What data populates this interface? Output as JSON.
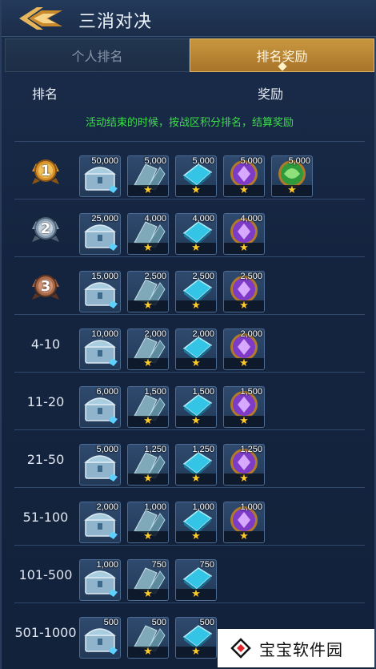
{
  "header": {
    "title": "三消对决"
  },
  "tabs": [
    {
      "label": "个人排名",
      "active": false
    },
    {
      "label": "排名奖励",
      "active": true
    }
  ],
  "columns": {
    "rank": "排名",
    "reward": "奖励"
  },
  "notice": "活动结束的时候，按战区积分排名，结算奖励",
  "rows": [
    {
      "rank_label": "",
      "medal": "gold",
      "medal_number": "1",
      "rewards": [
        {
          "type": "chest",
          "count": "50,000",
          "starred": false
        },
        {
          "type": "shard",
          "count": "5,000",
          "starred": true
        },
        {
          "type": "blue-gem",
          "count": "5,000",
          "starred": true
        },
        {
          "type": "purple-orb",
          "count": "5,000",
          "starred": true
        },
        {
          "type": "green-orb",
          "count": "5,000",
          "starred": true
        }
      ]
    },
    {
      "rank_label": "",
      "medal": "silver",
      "medal_number": "2",
      "rewards": [
        {
          "type": "chest",
          "count": "25,000",
          "starred": false
        },
        {
          "type": "shard",
          "count": "4,000",
          "starred": true
        },
        {
          "type": "blue-gem",
          "count": "4,000",
          "starred": true
        },
        {
          "type": "purple-orb",
          "count": "4,000",
          "starred": true
        }
      ]
    },
    {
      "rank_label": "",
      "medal": "bronze",
      "medal_number": "3",
      "rewards": [
        {
          "type": "chest",
          "count": "15,000",
          "starred": false
        },
        {
          "type": "shard",
          "count": "2,500",
          "starred": true
        },
        {
          "type": "blue-gem",
          "count": "2,500",
          "starred": true
        },
        {
          "type": "purple-orb",
          "count": "2,500",
          "starred": true
        }
      ]
    },
    {
      "rank_label": "4-10",
      "rewards": [
        {
          "type": "chest",
          "count": "10,000",
          "starred": false
        },
        {
          "type": "shard",
          "count": "2,000",
          "starred": true
        },
        {
          "type": "blue-gem",
          "count": "2,000",
          "starred": true
        },
        {
          "type": "purple-orb",
          "count": "2,000",
          "starred": true
        }
      ]
    },
    {
      "rank_label": "11-20",
      "rewards": [
        {
          "type": "chest",
          "count": "6,000",
          "starred": false
        },
        {
          "type": "shard",
          "count": "1,500",
          "starred": true
        },
        {
          "type": "blue-gem",
          "count": "1,500",
          "starred": true
        },
        {
          "type": "purple-orb",
          "count": "1,500",
          "starred": true
        }
      ]
    },
    {
      "rank_label": "21-50",
      "rewards": [
        {
          "type": "chest",
          "count": "5,000",
          "starred": false
        },
        {
          "type": "shard",
          "count": "1,250",
          "starred": true
        },
        {
          "type": "blue-gem",
          "count": "1,250",
          "starred": true
        },
        {
          "type": "purple-orb",
          "count": "1,250",
          "starred": true
        }
      ]
    },
    {
      "rank_label": "51-100",
      "rewards": [
        {
          "type": "chest",
          "count": "2,000",
          "starred": false
        },
        {
          "type": "shard",
          "count": "1,000",
          "starred": true
        },
        {
          "type": "blue-gem",
          "count": "1,000",
          "starred": true
        },
        {
          "type": "purple-orb",
          "count": "1,000",
          "starred": true
        }
      ]
    },
    {
      "rank_label": "101-500",
      "rewards": [
        {
          "type": "chest",
          "count": "1,000",
          "starred": false
        },
        {
          "type": "shard",
          "count": "750",
          "starred": true
        },
        {
          "type": "blue-gem",
          "count": "750",
          "starred": true
        }
      ]
    },
    {
      "rank_label": "501-1000",
      "rewards": [
        {
          "type": "chest",
          "count": "500",
          "starred": false
        },
        {
          "type": "shard",
          "count": "500",
          "starred": true
        },
        {
          "type": "blue-gem",
          "count": "500",
          "starred": true
        }
      ]
    }
  ],
  "star_glyph": "★",
  "watermark": {
    "text": "宝宝软件园"
  },
  "colors": {
    "accent_gold": "#c9963f",
    "notice_green": "#3ddc4a",
    "star": "#ffc928"
  }
}
